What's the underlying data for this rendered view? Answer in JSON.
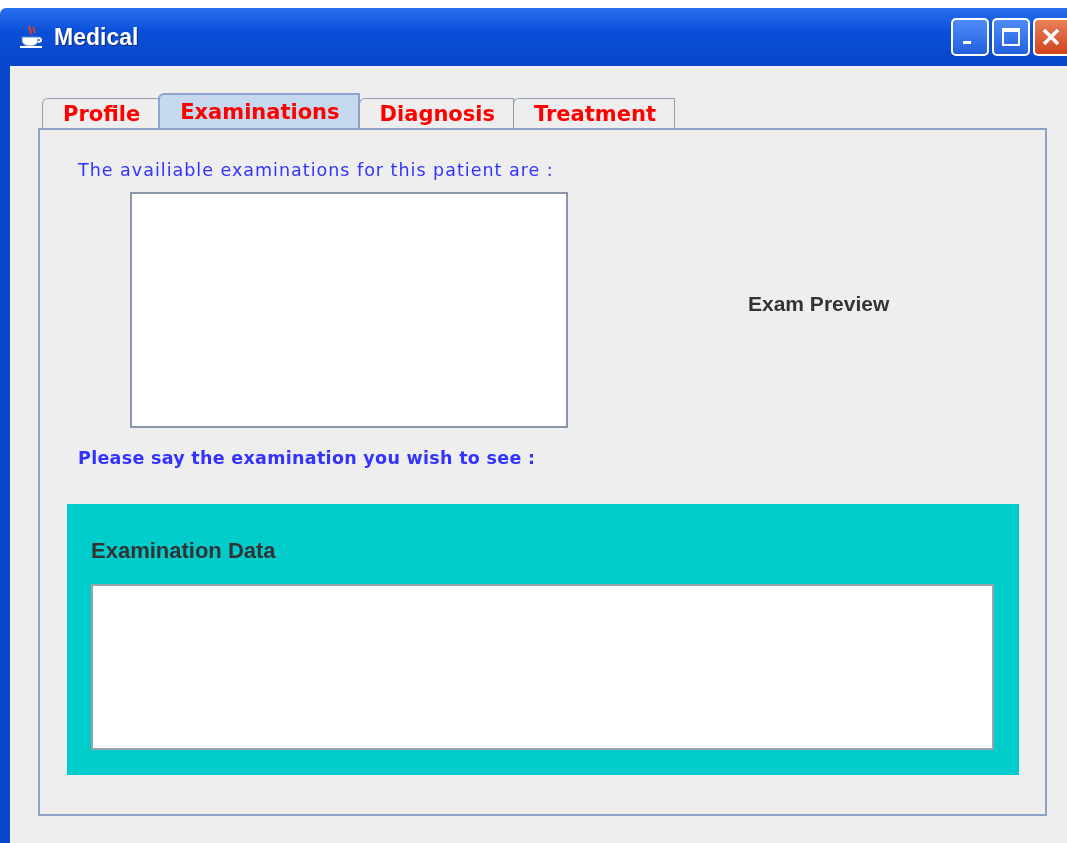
{
  "window": {
    "title": "Medical"
  },
  "tabs": [
    {
      "label": "Profile",
      "selected": false
    },
    {
      "label": "Examinations",
      "selected": true
    },
    {
      "label": "Diagnosis",
      "selected": false
    },
    {
      "label": "Treatment",
      "selected": false
    }
  ],
  "examinations": {
    "label": "The availiable examinations for this patient are :",
    "prompt": "Please say the examination you wish to see :"
  },
  "preview": {
    "label": "Exam Preview"
  },
  "examination_data": {
    "title": "Examination Data"
  }
}
